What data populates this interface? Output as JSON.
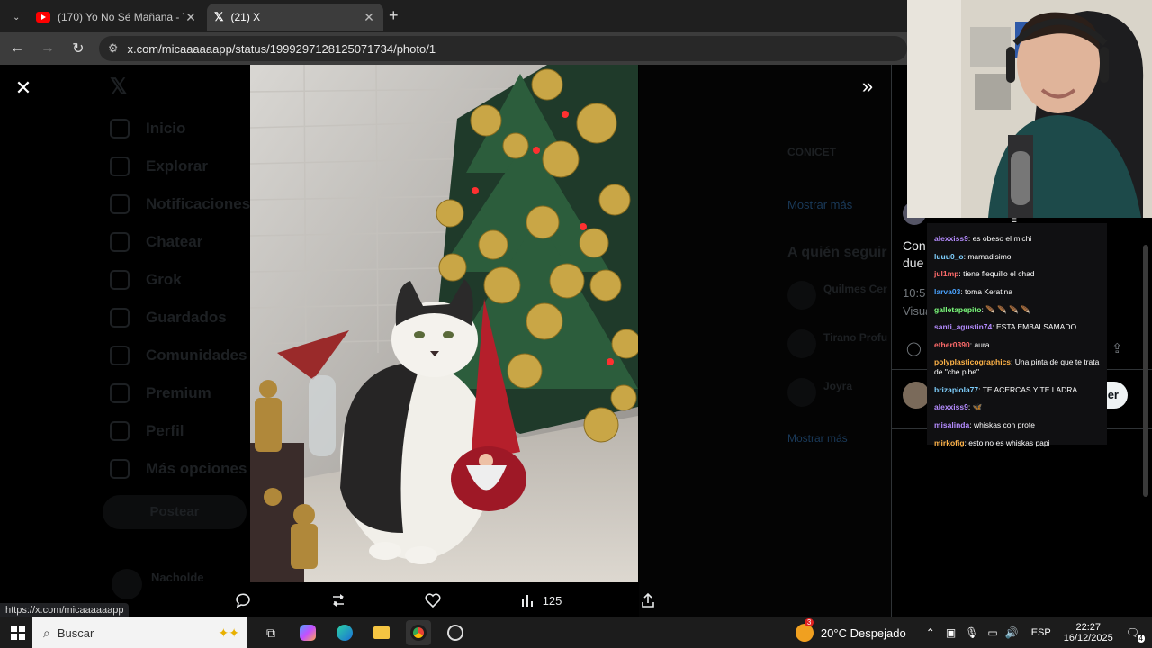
{
  "browser": {
    "tabs": [
      {
        "title": "(170) Yo No Sé Mañana - YouTube",
        "icon": "youtube-icon",
        "active": false
      },
      {
        "title": "(21) X",
        "icon": "x-logo-icon",
        "active": true
      }
    ],
    "url": "x.com/micaaaaaapp/status/1999297128125071734/photo/1",
    "status_url": "https://x.com/micaaaaaapp"
  },
  "sidebar": {
    "items": [
      "Inicio",
      "Explorar",
      "Notificaciones",
      "Chatear",
      "Grok",
      "Guardados",
      "Comunidades",
      "Premium",
      "Perfil",
      "Más opciones"
    ],
    "post_button": "Postear",
    "account_name": "Nacholde"
  },
  "trending": {
    "who_to_follow": "A quién seguir",
    "follow_names": [
      "Quilmes Cer",
      "Tirano Profu",
      "Joyra"
    ],
    "conicet": "CONICET",
    "show_more": "Mostrar más"
  },
  "post": {
    "text_partial": [
      "Con",
      "due"
    ],
    "time_partial": "10:5",
    "views_partial": "Visua",
    "reply_partial": "er"
  },
  "actions": {
    "views": "125"
  },
  "chat": [
    {
      "user": "alexxiss9",
      "color": "#b58cff",
      "text": "es obeso el michi"
    },
    {
      "user": "luuu0_o",
      "color": "#7fd0ff",
      "text": "mamadisimo"
    },
    {
      "user": "jul1mp",
      "color": "#ff6b6b",
      "text": "tiene flequillo el chad"
    },
    {
      "user": "larva03",
      "color": "#4aa3ff",
      "text": "toma Keratina"
    },
    {
      "user": "galletapepito",
      "color": "#7dff7d",
      "text": "🪶 🪶 🪶 🪶"
    },
    {
      "user": "santi_agustin74",
      "color": "#b58cff",
      "text": "ESTA EMBALSAMADO"
    },
    {
      "user": "ether0390",
      "color": "#ff6b6b",
      "text": "aura"
    },
    {
      "user": "polyplasticographics",
      "color": "#ffb347",
      "text": "Una pinta de que te trata de \"che pibe\""
    },
    {
      "user": "brizapiola77",
      "color": "#7fd0ff",
      "text": "TE ACERCAS Y TE LADRA"
    },
    {
      "user": "alexxiss9",
      "color": "#b58cff",
      "text": "🦋"
    },
    {
      "user": "misalinda",
      "color": "#b58cff",
      "text": "whiskas con prote"
    },
    {
      "user": "mirkofig",
      "color": "#ffb347",
      "text": "esto no es whiskas papi"
    }
  ],
  "taskbar": {
    "search_placeholder": "Buscar",
    "weather": "20°C  Despejado",
    "weather_badge": "3",
    "language": "ESP",
    "time": "22:27",
    "date": "16/12/2025",
    "notif_count": "4"
  }
}
